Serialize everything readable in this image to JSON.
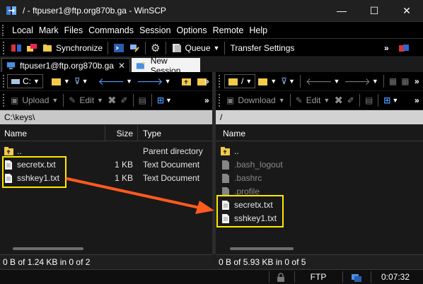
{
  "window": {
    "title": "/ - ftpuser1@ftp.org870b.ga - WinSCP",
    "minimize_glyph": "—",
    "maximize_glyph": "☐",
    "close_glyph": "✕"
  },
  "menu": [
    "Local",
    "Mark",
    "Files",
    "Commands",
    "Session",
    "Options",
    "Remote",
    "Help"
  ],
  "toolbar": {
    "synchronize": "Synchronize",
    "queue": "Queue",
    "transfer_settings": "Transfer Settings",
    "chevron": "»"
  },
  "tabs": {
    "session": "ftpuser1@ftp.org870b.ga",
    "close_glyph": "✕",
    "new_session": "New Session"
  },
  "left": {
    "drive": "C:",
    "upload": "Upload",
    "edit": "Edit",
    "path": "C:\\keys\\",
    "columns": {
      "name": "Name",
      "size": "Size",
      "type": "Type"
    },
    "rows": [
      {
        "name": "..",
        "size": "",
        "type": "Parent directory",
        "icon": "folder-up-icon"
      },
      {
        "name": "secretx.txt",
        "size": "1 KB",
        "type": "Text Document",
        "icon": "file-icon"
      },
      {
        "name": "sshkey1.txt",
        "size": "1 KB",
        "type": "Text Document",
        "icon": "file-icon"
      }
    ],
    "status": "0 B of 1.24 KB in 0 of 2"
  },
  "right": {
    "drive": "/",
    "download": "Download",
    "edit": "Edit",
    "path": "/",
    "columns": {
      "name": "Name"
    },
    "rows": [
      {
        "name": "..",
        "icon": "folder-up-icon",
        "hidden": false
      },
      {
        "name": ".bash_logout",
        "icon": "file-icon",
        "hidden": true
      },
      {
        "name": ".bashrc",
        "icon": "file-icon",
        "hidden": true
      },
      {
        "name": ".profile",
        "icon": "file-icon",
        "hidden": true
      },
      {
        "name": "secretx.txt",
        "icon": "file-icon",
        "hidden": false
      },
      {
        "name": "sshkey1.txt",
        "icon": "file-icon",
        "hidden": false
      }
    ],
    "status": "0 B of 5.93 KB in 0 of 5"
  },
  "statusbar": {
    "protocol": "FTP",
    "time": "0:07:32"
  },
  "colors": {
    "highlight": "#ffea00",
    "arrow": "#ff5a1f",
    "folder": "#f2c94c"
  }
}
